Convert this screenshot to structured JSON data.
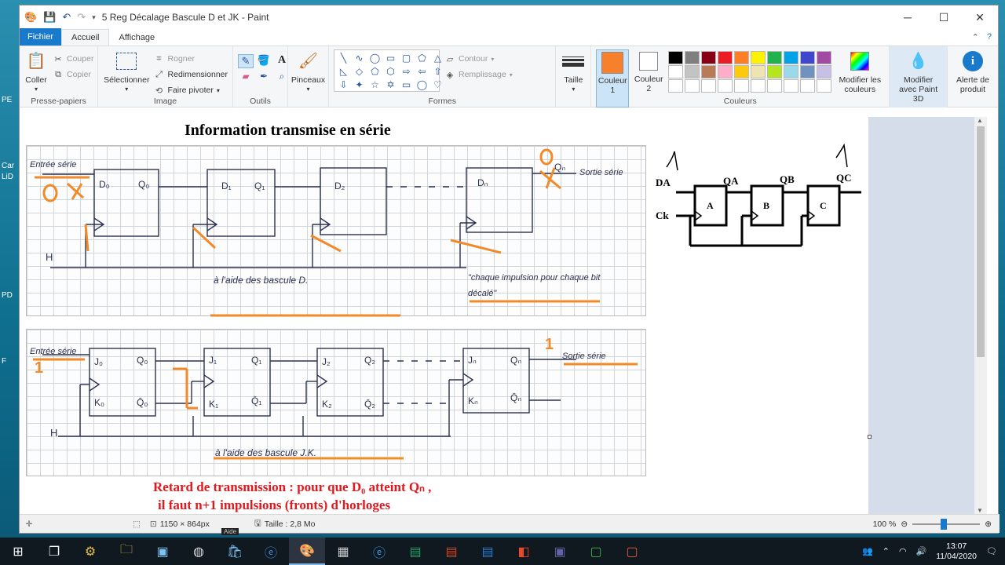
{
  "window": {
    "title": "5 Reg Décalage Bascule D et JK - Paint",
    "minimize": "─",
    "maximize": "☐",
    "close": "✕"
  },
  "tabs": {
    "file": "Fichier",
    "home": "Accueil",
    "view": "Affichage"
  },
  "ribbon": {
    "clipboard": {
      "label": "Presse-papiers",
      "paste": "Coller",
      "cut": "Couper",
      "copy": "Copier"
    },
    "image": {
      "label": "Image",
      "select": "Sélectionner",
      "crop": "Rogner",
      "resize": "Redimensionner",
      "rotate": "Faire pivoter"
    },
    "tools": {
      "label": "Outils"
    },
    "brushes": {
      "label": "Pinceaux"
    },
    "shapes": {
      "label": "Formes",
      "outline": "Contour",
      "fill": "Remplissage"
    },
    "size": {
      "label": "Taille"
    },
    "colors": {
      "label": "Couleurs",
      "color1": "Couleur 1",
      "color2": "Couleur 2",
      "edit": "Modifier les couleurs",
      "color1_value": "#f6802b",
      "color2_value": "#ffffff",
      "palette_row1": [
        "#000000",
        "#7f7f7f",
        "#880015",
        "#ed1c24",
        "#ff7f27",
        "#fff200",
        "#22b14c",
        "#00a2e8",
        "#3f48cc",
        "#a349a4"
      ],
      "palette_row2": [
        "#ffffff",
        "#c3c3c3",
        "#b97a57",
        "#ffaec9",
        "#ffc90e",
        "#efe4b0",
        "#b5e61d",
        "#99d9ea",
        "#7092be",
        "#c8bfe7"
      ]
    },
    "paint3d": "Modifier avec Paint 3D",
    "alert": "Alerte de produit"
  },
  "desktop_labels": [
    "PE",
    "Car",
    "LiD",
    "PD",
    "F"
  ],
  "canvas": {
    "title": "Information transmise en série",
    "top": {
      "entree": "Entrée série",
      "sortie": "Sortie série",
      "zero": "0",
      "zero2": "0",
      "d0": "D₀",
      "q0": "Q₀",
      "d1": "D₁",
      "q1": "Q₁",
      "d2": "D₂",
      "dn": "Dₙ",
      "qn": "Qₙ",
      "h": "H",
      "caption": "à l'aide des bascule D.",
      "note": "\"chaque impulsion pour chaque bit décalé\""
    },
    "bottom": {
      "entree": "Entrée série",
      "sortie": "Sortie série",
      "one": "1",
      "one2": "1",
      "j0": "J₀",
      "k0": "K₀",
      "q0": "Q₀",
      "q0b": "Q̄₀",
      "j1": "J₁",
      "k1": "K₁",
      "q1": "Q₁",
      "q1b": "Q̄₁",
      "j2": "J₂",
      "k2": "K₂",
      "q2": "Q₂",
      "q2b": "Q̄₂",
      "jn": "Jₙ",
      "kn": "Kₙ",
      "qn": "Qₙ",
      "qnb": "Q̄ₙ",
      "h": "H",
      "caption": "à l'aide des bascule J.K."
    },
    "right": {
      "one_a": "1",
      "one_b": "1",
      "da": "DA",
      "qa": "QA",
      "qb": "QB",
      "qc": "QC",
      "ck": "Ck",
      "a": "A",
      "b": "B",
      "c": "C"
    },
    "retard_line1": "Retard de transmission : pour que D₀ atteint Qₙ ,",
    "retard_line2": "il faut n+1  impulsions (fronts) d'horloges"
  },
  "status": {
    "dimensions": "1150 × 864px",
    "size": "Taille : 2,8 Mo",
    "zoom": "100 %"
  },
  "taskbar": {
    "time": "13:07",
    "date": "11/04/2020",
    "tooltip": "Aide"
  }
}
